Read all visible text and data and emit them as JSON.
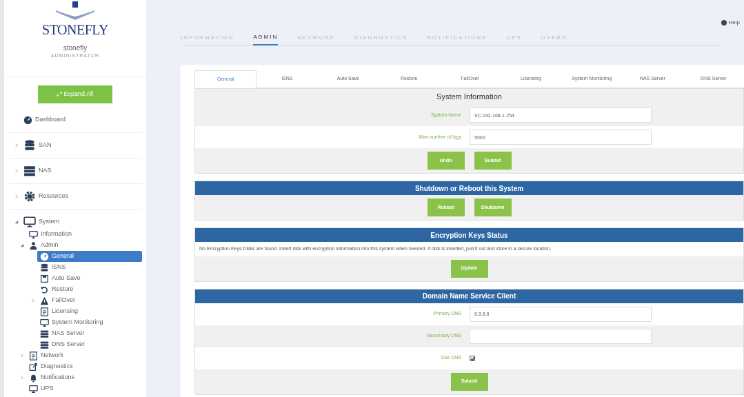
{
  "sidebar": {
    "logo_text": "STONEFLY",
    "user": "stonefly",
    "role": "ADMINISTRATOR",
    "expand_button": "⤢ Expand All",
    "tree": [
      {
        "label": "Dashboard",
        "kind": "dashboard",
        "selected": false
      },
      {
        "label": "SAN",
        "kind": "database",
        "expanded": false,
        "selected": false
      },
      {
        "label": "NAS",
        "kind": "server",
        "expanded": false,
        "selected": false
      },
      {
        "label": "Resources",
        "kind": "gear",
        "expanded": false,
        "selected": false
      },
      {
        "label": "System",
        "kind": "monitor",
        "expanded": true,
        "selected": false,
        "children": [
          {
            "label": "Information",
            "kind": "monitor",
            "selected": false
          },
          {
            "label": "Admin",
            "kind": "user",
            "expanded": true,
            "selected": false,
            "children": [
              {
                "label": "General",
                "kind": "gauge",
                "selected": true
              },
              {
                "label": "iSNS",
                "kind": "database",
                "selected": false
              },
              {
                "label": "Auto Save",
                "kind": "save",
                "selected": false
              },
              {
                "label": "Restore",
                "kind": "undo",
                "selected": false
              },
              {
                "label": "FailOver",
                "kind": "warning",
                "expanded": false,
                "selected": false
              },
              {
                "label": "Licensing",
                "kind": "document",
                "selected": false
              },
              {
                "label": "System Monitoring",
                "kind": "monitor",
                "selected": false
              },
              {
                "label": "NAS Server",
                "kind": "server",
                "selected": false
              },
              {
                "label": "DNS Server",
                "kind": "server",
                "selected": false
              }
            ]
          },
          {
            "label": "Network",
            "kind": "document",
            "expanded": false,
            "selected": false
          },
          {
            "label": "Diagnostics",
            "kind": "external",
            "selected": false
          },
          {
            "label": "Notifications",
            "kind": "bell",
            "expanded": false,
            "selected": false
          },
          {
            "label": "UPS",
            "kind": "monitor",
            "selected": false
          }
        ]
      }
    ]
  },
  "help": "Help",
  "top_tabs": [
    {
      "label": "INFORMATION",
      "selected": false
    },
    {
      "label": "ADMIN",
      "selected": true
    },
    {
      "label": "NETWORK",
      "selected": false
    },
    {
      "label": "DIAGNOSTICS",
      "selected": false
    },
    {
      "label": "NOTIFICATIONS",
      "selected": false
    },
    {
      "label": "UPS",
      "selected": false
    },
    {
      "label": "USERS",
      "selected": false
    }
  ],
  "sub_tabs": [
    {
      "label": "General",
      "selected": true
    },
    {
      "label": "iSNS",
      "selected": false
    },
    {
      "label": "Auto Save",
      "selected": false
    },
    {
      "label": "Restore",
      "selected": false
    },
    {
      "label": "FailOver",
      "selected": false
    },
    {
      "label": "Licensing",
      "selected": false
    },
    {
      "label": "System Monitoring",
      "selected": false
    },
    {
      "label": "NAS Server",
      "selected": false
    },
    {
      "label": "DNS Server",
      "selected": false
    }
  ],
  "panels": [
    {
      "title": "System Information",
      "kind": "form",
      "rows": [
        {
          "kind": "text",
          "label": "System Name",
          "value": "SC-192-168-1-254"
        },
        {
          "kind": "text",
          "label": "Max number of logs",
          "value": "5000"
        }
      ],
      "buttons": [
        "Undo",
        "Submit"
      ]
    },
    {
      "title": "Shutdown or Reboot this System",
      "kind": "section",
      "buttons": [
        "Reboot",
        "Shutdown"
      ]
    },
    {
      "title": "Encryption Keys Status",
      "kind": "section",
      "message": "No Encryption Keys Disks are found. Insert disk with encryption information into this system when needed. If disk is inserted, pull it out and store in a secure location.",
      "buttons": [
        "Update"
      ]
    },
    {
      "title": "Domain Name Service Client",
      "kind": "section",
      "rows": [
        {
          "kind": "text",
          "label": "Primary DNS",
          "value": "8.8.8.8"
        },
        {
          "kind": "text",
          "label": "Secondary DNS"
        },
        {
          "kind": "checkbox",
          "label": "Use DNS",
          "checked": true
        }
      ],
      "buttons": [
        "Submit"
      ]
    }
  ]
}
